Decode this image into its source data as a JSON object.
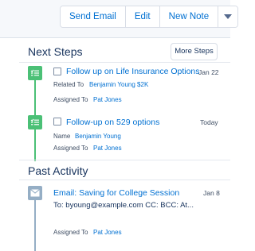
{
  "toolbar": {
    "send_email": "Send Email",
    "edit": "Edit",
    "new_note": "New Note",
    "more_menu_icon": "chevron-down-icon"
  },
  "next_steps": {
    "title": "Next Steps",
    "more_button": "More Steps",
    "items": [
      {
        "icon": "task-icon",
        "subject": "Follow up on Life Insurance Options",
        "date": "Jan 22",
        "field1_label": "Related To",
        "field1_value": "Benjamin Young $2K",
        "field2_label": "Assigned To",
        "field2_value": "Pat Jones"
      },
      {
        "icon": "task-icon",
        "subject": "Follow-up on 529 options",
        "date": "Today",
        "field1_label": "Name",
        "field1_value": "Benjamin Young",
        "field2_label": "Assigned To",
        "field2_value": "Pat Jones"
      }
    ]
  },
  "past_activity": {
    "title": "Past Activity",
    "items": [
      {
        "icon": "email-icon",
        "subject": "Email: Saving for College Session",
        "date": "Jan 8",
        "recipients": "To: byoung@example.com CC: BCC: At...",
        "field2_label": "Assigned To",
        "field2_value": "Pat Jones"
      }
    ]
  },
  "colors": {
    "task_green": "#4bc076",
    "email_grey": "#95aec5",
    "link_blue": "#0070d2"
  }
}
